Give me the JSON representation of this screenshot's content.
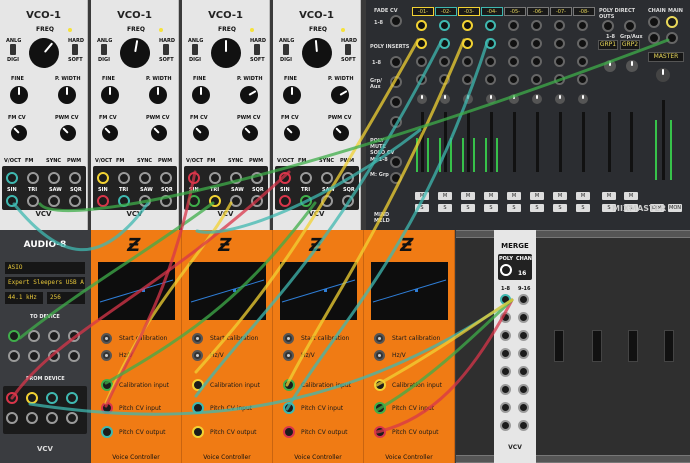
{
  "vco": {
    "title": "VCO-1",
    "freq": "FREQ",
    "anlg": "ANLG",
    "digi": "DIGI",
    "hard": "HARD",
    "soft": "SOFT",
    "fine": "FINE",
    "pwidth": "P. WIDTH",
    "fmcv": "FM CV",
    "pwmcv": "PWM CV",
    "in_labels": [
      "V/OCT",
      "FM",
      "SYNC",
      "PWM"
    ],
    "out_labels": [
      "SIN",
      "TRI",
      "SAW",
      "SQR"
    ],
    "brand": "VCV"
  },
  "mix": {
    "fade_cv": "FADE CV",
    "range_1_8": "1-8",
    "poly_inserts": "POLY INSERTS",
    "grp_aux": "Grp/ Aux",
    "poly_mute": "POLY MUTE SOLO CV",
    "m1": "M: 1-8",
    "m2": "M: Grp",
    "channels": [
      "-01-",
      "-02-",
      "-03-",
      "-04-",
      "-05-",
      "-06-",
      "-07-",
      "-08-"
    ],
    "poly_direct_outs": "POLY DIRECT OUTS",
    "grp_aux2": "Grp/Aux",
    "chain": "CHAIN",
    "main": "MAIN",
    "grp1": "GRP1",
    "grp2": "GRP2",
    "master": "MASTER",
    "m": "M",
    "s": "S",
    "dim": "DIM",
    "mon": "MON",
    "brand": "MIXMASTER",
    "maker": "MIND MELD"
  },
  "audio": {
    "title": "AUDIO-8",
    "driver": "ASIO",
    "device": "Expert Sleepers USB A",
    "rate": "44.1 kHz",
    "block": "256",
    "to_device": "TO DEVICE",
    "from_device": "FROM DEVICE",
    "brand": "VCV"
  },
  "vc": {
    "start": "Start calibration",
    "hzv": "Hz/V",
    "cal_in": "Calibration input",
    "pitch_in": "Pitch CV input",
    "pitch_out": "Pitch CV output",
    "name": "Voice Controller"
  },
  "merge": {
    "title": "MERGE",
    "poly": "POLY",
    "chan": "CHAN",
    "r1": "1-8",
    "r2": "9-16",
    "brand": "VCV"
  },
  "colors": {
    "yellow": "#f2d233",
    "teal": "#3fb8b0",
    "red": "#d8364a",
    "green": "#3fae4a",
    "orange": "#f07b14"
  }
}
